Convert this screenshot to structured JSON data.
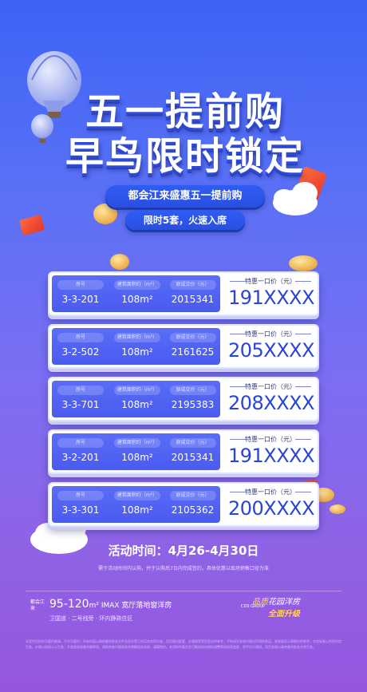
{
  "title": {
    "line1": "五一提前购",
    "line2": "早鸟限时锁定"
  },
  "tag_primary": "都会江来盛惠五一提前购",
  "tag_secondary": "限时5套，火速入席",
  "headers": {
    "room": "房号",
    "area": "建筑面积约（m²）",
    "original": "原成交价（元）",
    "special": "特惠一口价（元）"
  },
  "units": [
    {
      "room": "3-3-201",
      "area": "108m²",
      "original": "2015341",
      "special": "191XXXX"
    },
    {
      "room": "3-2-502",
      "area": "108m²",
      "original": "2161625",
      "special": "205XXXX"
    },
    {
      "room": "3-3-701",
      "area": "108m²",
      "original": "2195383",
      "special": "208XXXX"
    },
    {
      "room": "3-2-201",
      "area": "108m²",
      "original": "2015341",
      "special": "191XXXX"
    },
    {
      "room": "3-3-301",
      "area": "108m²",
      "original": "2105362",
      "special": "200XXXX"
    }
  ],
  "activity_time": "活动时间：4月26-4月30日",
  "disclaimer": "需于活动时间内认购，并于认购后7日内完成签约，具体优惠以现场销售口径为准",
  "footer": {
    "brand": "都会江来",
    "area_range": "95-120",
    "area_suffix": "m² IMAX 宽厅落地窗洋房",
    "sub": "卫国道 · 二号线旁 · 环内静熟住区",
    "logo_main": "品质",
    "logo_script": "花园洋房",
    "logo_sub": "全面升级",
    "logo_small": "CDS GROUP"
  },
  "legal_text": "本宣传资料仅为要约邀请，不作为要约，所有内容以政府最终批准文件及双方签订的买卖合同为准。项目周边配套、交通规划等信息仅供参考，不构成开发商对周边环境的承诺。效果图及示意图仅供参考，交房标准以合同约定为准。价格以现场公示为准，开发商保留最终解释权。请购房者仔细阅读并理解相关条款，谨慎购房。本资料所载信息可能因政府规划调整等原因而变更，恕不另行通知。项目名称以政府最终批准名称为准。"
}
